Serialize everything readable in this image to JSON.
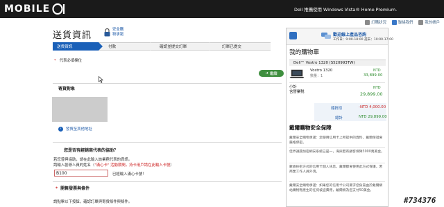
{
  "brand": {
    "logo_text": "MOBILE"
  },
  "header": {
    "tagline": "Dell 推薦使用 Windows Vista® Home Premium."
  },
  "nav": {
    "items": [
      {
        "label": "訂購狀況",
        "color": "#8a8a8a"
      },
      {
        "label": "聯絡我們",
        "color": "#3a78c8"
      },
      {
        "label": "我的帳戶",
        "color": "#8a8a8a"
      }
    ]
  },
  "page": {
    "title": "送貨資訊",
    "secure_line1": "安全購",
    "secure_line2": "物承諾",
    "steps": [
      "送貨資訊",
      "付款",
      "確認並提交訂單",
      "訂單已提交"
    ],
    "required_note": "代表必填欄位",
    "next_button": "繼續",
    "shipping_object_heading": "寄貨對象",
    "change_address_link": "發貨至其他地址",
    "vendor_question": "您是否有經銷商代表的協助？",
    "vendor_text_1": "若您曾與協助，請在此輸入該業務代表的資訊。",
    "vendor_text_2_prefix": "請輸入創辦人員的姓名（",
    "vendor_text_2_red": "\"滿心卡\" 活動期間，持卡用戶請在此輸入卡號",
    "vendor_text_2_suffix": "）",
    "name_input_value": "B100",
    "input_hint": "已經輸入滿心卡號！",
    "invoice_heading": "開售發票與條件",
    "last_text": "請點擊以下按鈕，確認訂單與寄貨條件與條件。"
  },
  "sidebar": {
    "contact_title": "歡迎線上產品咨詢",
    "contact_hours": "工作日：9:00-18:00  週末：10:00-17:00",
    "cart_title": "我的購物車",
    "product_header": "Dell™ Vostro 1320 (S520993TW)",
    "product_name": "Vostro 1320",
    "product_qty": "數量：1",
    "currency": "NTD",
    "product_price": "33,899.00",
    "subtotal_label": "小計",
    "subtotal_sub": "含營業稅",
    "subtotal_price": "29,899.00",
    "discount_label": "總折扣",
    "discount_value": "-NTD 4,000.00",
    "total_label": "總計",
    "total_value": "NTD 29,899.00",
    "safety_title": "戴爾購物安全保障",
    "safety_p1": "戴爾安全購物承諾：您使用信用卡上所提供的資料，戴爾保證會嚴格保密。",
    "safety_p2": "佳界議題加密網安系統已是一，海與若有顧客保障3000萬美金。",
    "safety_p3": "數據採密方式的信用卡個人訊息，戴爾都會使用此方式保護，若商業工作人員外洩。",
    "safety_p4": "戴爾安全購物承諾：如果您的信用卡公司要求您負責由於戴爾網站購物而產生的任何被盜費用，戴爾將為您支付50美金。"
  },
  "watermark": "#734376"
}
